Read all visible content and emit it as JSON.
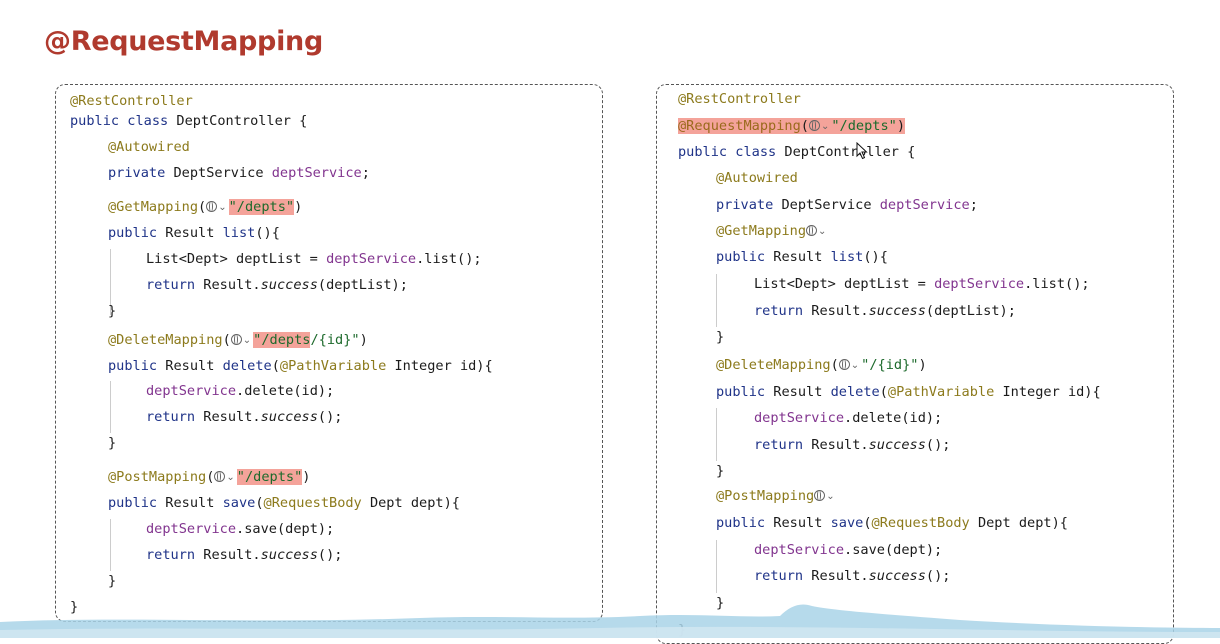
{
  "slide": {
    "title": "@RequestMapping"
  },
  "panels": [
    {
      "id": "left",
      "lines": [
        {
          "indent": 0,
          "tokens": [
            {
              "t": "@RestController",
              "c": "ann"
            }
          ]
        },
        {
          "indent": 0,
          "tokens": [
            {
              "t": "public ",
              "c": "kw"
            },
            {
              "t": "class ",
              "c": "kw"
            },
            {
              "t": "DeptController {",
              "c": "plain"
            }
          ]
        },
        {
          "indent": 1,
          "tokens": [
            {
              "t": "@Autowired",
              "c": "ann"
            }
          ]
        },
        {
          "indent": 1,
          "tokens": [
            {
              "t": "private ",
              "c": "kw"
            },
            {
              "t": "DeptService ",
              "c": "plain"
            },
            {
              "t": "deptService",
              "c": "field"
            },
            {
              "t": ";",
              "c": "plain"
            }
          ]
        },
        {
          "indent": 1,
          "tokens": [
            {
              "t": "@GetMapping",
              "c": "ann"
            },
            {
              "t": "(",
              "c": "plain"
            },
            {
              "icon": "globe"
            },
            {
              "t": "\"/depts\"",
              "c": "str",
              "hl": true
            },
            {
              "t": ")",
              "c": "plain"
            }
          ]
        },
        {
          "indent": 1,
          "tokens": [
            {
              "t": "public ",
              "c": "kw"
            },
            {
              "t": "Result ",
              "c": "plain"
            },
            {
              "t": "list",
              "c": "kw"
            },
            {
              "t": "(){",
              "c": "plain"
            }
          ]
        },
        {
          "indent": 2,
          "tokens": [
            {
              "t": "List<Dept> deptList = ",
              "c": "plain"
            },
            {
              "t": "deptService",
              "c": "field"
            },
            {
              "t": ".list();",
              "c": "plain"
            }
          ]
        },
        {
          "indent": 2,
          "tokens": [
            {
              "t": "return ",
              "c": "kw"
            },
            {
              "t": "Result.",
              "c": "plain"
            },
            {
              "t": "success",
              "c": "italic"
            },
            {
              "t": "(deptList);",
              "c": "plain"
            }
          ]
        },
        {
          "indent": 1,
          "tokens": [
            {
              "t": "}",
              "c": "plain"
            }
          ]
        },
        {
          "indent": 1,
          "tokens": [
            {
              "t": "@DeleteMapping",
              "c": "ann"
            },
            {
              "t": "(",
              "c": "plain"
            },
            {
              "icon": "globe"
            },
            {
              "t": "\"/depts",
              "c": "str",
              "hl": true
            },
            {
              "t": "/{id}\"",
              "c": "str"
            },
            {
              "t": ")",
              "c": "plain"
            }
          ]
        },
        {
          "indent": 1,
          "tokens": [
            {
              "t": "public ",
              "c": "kw"
            },
            {
              "t": "Result ",
              "c": "plain"
            },
            {
              "t": "delete",
              "c": "kw"
            },
            {
              "t": "(",
              "c": "plain"
            },
            {
              "t": "@PathVariable ",
              "c": "ann"
            },
            {
              "t": "Integer id){",
              "c": "plain"
            }
          ]
        },
        {
          "indent": 2,
          "tokens": [
            {
              "t": "deptService",
              "c": "field"
            },
            {
              "t": ".delete(id);",
              "c": "plain"
            }
          ]
        },
        {
          "indent": 2,
          "tokens": [
            {
              "t": "return ",
              "c": "kw"
            },
            {
              "t": "Result.",
              "c": "plain"
            },
            {
              "t": "success",
              "c": "italic"
            },
            {
              "t": "();",
              "c": "plain"
            }
          ]
        },
        {
          "indent": 1,
          "tokens": [
            {
              "t": "}",
              "c": "plain"
            }
          ]
        },
        {
          "indent": 1,
          "tokens": [
            {
              "t": "@PostMapping",
              "c": "ann"
            },
            {
              "t": "(",
              "c": "plain"
            },
            {
              "icon": "globe"
            },
            {
              "t": "\"/depts\"",
              "c": "str",
              "hl": true
            },
            {
              "t": ")",
              "c": "plain"
            }
          ]
        },
        {
          "indent": 1,
          "tokens": [
            {
              "t": "public ",
              "c": "kw"
            },
            {
              "t": "Result ",
              "c": "plain"
            },
            {
              "t": "save",
              "c": "kw"
            },
            {
              "t": "(",
              "c": "plain"
            },
            {
              "t": "@RequestBody ",
              "c": "ann"
            },
            {
              "t": "Dept dept){",
              "c": "plain"
            }
          ]
        },
        {
          "indent": 2,
          "tokens": [
            {
              "t": "deptService",
              "c": "field"
            },
            {
              "t": ".save(dept);",
              "c": "plain"
            }
          ]
        },
        {
          "indent": 2,
          "tokens": [
            {
              "t": "return ",
              "c": "kw"
            },
            {
              "t": "Result.",
              "c": "plain"
            },
            {
              "t": "success",
              "c": "italic"
            },
            {
              "t": "();",
              "c": "plain"
            }
          ]
        },
        {
          "indent": 1,
          "tokens": [
            {
              "t": "}",
              "c": "plain"
            }
          ]
        },
        {
          "indent": 0,
          "tokens": [
            {
              "t": "}",
              "c": "plain"
            }
          ]
        }
      ]
    },
    {
      "id": "right",
      "lines": [
        {
          "indent": 0,
          "tokens": [
            {
              "t": "@RestController",
              "c": "ann"
            }
          ]
        },
        {
          "indent": 0,
          "tokens": [
            {
              "t": "@RequestMapping",
              "c": "ann",
              "hl": true
            },
            {
              "t": "(",
              "c": "plain",
              "hl": true
            },
            {
              "icon": "globe",
              "hl": true
            },
            {
              "t": "\"/depts\"",
              "c": "str",
              "hl": true
            },
            {
              "t": ")",
              "c": "plain",
              "hl": true
            }
          ]
        },
        {
          "indent": 0,
          "tokens": [
            {
              "t": "public ",
              "c": "kw"
            },
            {
              "t": "class ",
              "c": "kw"
            },
            {
              "t": "DeptController {",
              "c": "plain"
            }
          ]
        },
        {
          "indent": 1,
          "tokens": [
            {
              "t": "@Autowired",
              "c": "ann"
            }
          ]
        },
        {
          "indent": 1,
          "tokens": [
            {
              "t": "private ",
              "c": "kw"
            },
            {
              "t": "DeptService ",
              "c": "plain"
            },
            {
              "t": "deptService",
              "c": "field"
            },
            {
              "t": ";",
              "c": "plain"
            }
          ]
        },
        {
          "indent": 1,
          "tokens": [
            {
              "t": "@GetMapping",
              "c": "ann"
            },
            {
              "icon": "globe"
            }
          ]
        },
        {
          "indent": 1,
          "tokens": [
            {
              "t": "public ",
              "c": "kw"
            },
            {
              "t": "Result ",
              "c": "plain"
            },
            {
              "t": "list",
              "c": "kw"
            },
            {
              "t": "(){",
              "c": "plain"
            }
          ]
        },
        {
          "indent": 2,
          "tokens": [
            {
              "t": "List<Dept> deptList = ",
              "c": "plain"
            },
            {
              "t": "deptService",
              "c": "field"
            },
            {
              "t": ".list();",
              "c": "plain"
            }
          ]
        },
        {
          "indent": 2,
          "tokens": [
            {
              "t": "return ",
              "c": "kw"
            },
            {
              "t": "Result.",
              "c": "plain"
            },
            {
              "t": "success",
              "c": "italic"
            },
            {
              "t": "(deptList);",
              "c": "plain"
            }
          ]
        },
        {
          "indent": 1,
          "tokens": [
            {
              "t": "}",
              "c": "plain"
            }
          ]
        },
        {
          "indent": 1,
          "tokens": [
            {
              "t": "@DeleteMapping",
              "c": "ann"
            },
            {
              "t": "(",
              "c": "plain"
            },
            {
              "icon": "globe"
            },
            {
              "t": "\"/{id}\"",
              "c": "str"
            },
            {
              "t": ")",
              "c": "plain"
            }
          ]
        },
        {
          "indent": 1,
          "tokens": [
            {
              "t": "public ",
              "c": "kw"
            },
            {
              "t": "Result ",
              "c": "plain"
            },
            {
              "t": "delete",
              "c": "kw"
            },
            {
              "t": "(",
              "c": "plain"
            },
            {
              "t": "@PathVariable ",
              "c": "ann"
            },
            {
              "t": "Integer id){",
              "c": "plain"
            }
          ]
        },
        {
          "indent": 2,
          "tokens": [
            {
              "t": "deptService",
              "c": "field"
            },
            {
              "t": ".delete(id);",
              "c": "plain"
            }
          ]
        },
        {
          "indent": 2,
          "tokens": [
            {
              "t": "return ",
              "c": "kw"
            },
            {
              "t": "Result.",
              "c": "plain"
            },
            {
              "t": "success",
              "c": "italic"
            },
            {
              "t": "();",
              "c": "plain"
            }
          ]
        },
        {
          "indent": 1,
          "tokens": [
            {
              "t": "}",
              "c": "plain"
            }
          ]
        },
        {
          "indent": 1,
          "tokens": [
            {
              "t": "@PostMapping",
              "c": "ann"
            },
            {
              "icon": "globe"
            }
          ]
        },
        {
          "indent": 1,
          "tokens": [
            {
              "t": "public ",
              "c": "kw"
            },
            {
              "t": "Result ",
              "c": "plain"
            },
            {
              "t": "save",
              "c": "kw"
            },
            {
              "t": "(",
              "c": "plain"
            },
            {
              "t": "@RequestBody ",
              "c": "ann"
            },
            {
              "t": "Dept dept){",
              "c": "plain"
            }
          ]
        },
        {
          "indent": 2,
          "tokens": [
            {
              "t": "deptService",
              "c": "field"
            },
            {
              "t": ".save(dept);",
              "c": "plain"
            }
          ]
        },
        {
          "indent": 2,
          "tokens": [
            {
              "t": "return ",
              "c": "kw"
            },
            {
              "t": "Result.",
              "c": "plain"
            },
            {
              "t": "success",
              "c": "italic"
            },
            {
              "t": "();",
              "c": "plain"
            }
          ]
        },
        {
          "indent": 1,
          "tokens": [
            {
              "t": "}",
              "c": "plain"
            }
          ]
        },
        {
          "indent": 0,
          "tokens": [
            {
              "t": "}",
              "c": "plain"
            }
          ]
        }
      ]
    }
  ],
  "colors": {
    "title": "#b03a2e",
    "keyword": "#1f3388",
    "annotation": "#8c7a1c",
    "string": "#1d6a2c",
    "field": "#82358f",
    "highlight": "#f4a39a"
  },
  "icons": {
    "globe": "globe-icon",
    "chevron": "chevron-down-icon",
    "cursor": "mouse-cursor-icon"
  }
}
